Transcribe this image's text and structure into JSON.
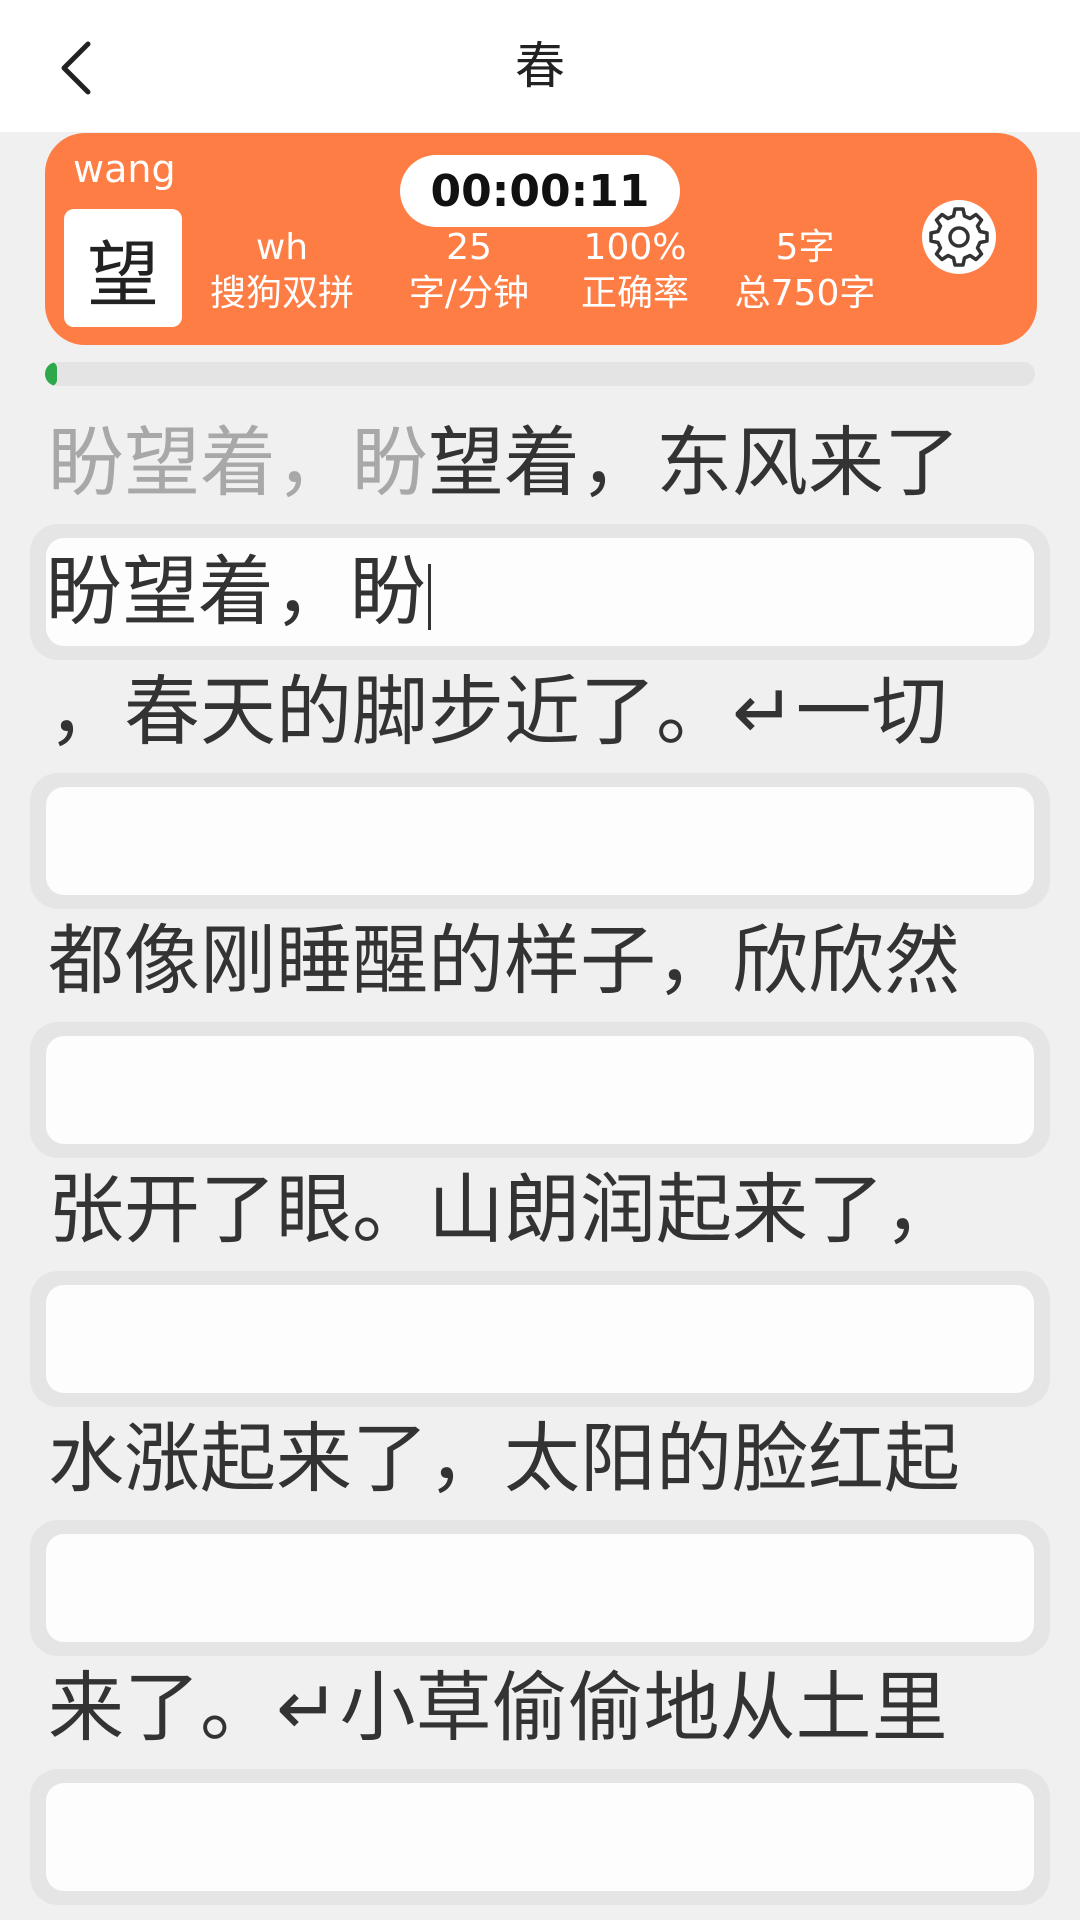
{
  "header": {
    "title": "春"
  },
  "stats": {
    "pinyin": "wang",
    "current_char": "望",
    "timer": "00:00:11",
    "scheme_value": "wh",
    "scheme_label": "搜狗双拼",
    "speed_value": "25",
    "speed_label": "字/分钟",
    "accuracy_value": "100%",
    "accuracy_label": "正确率",
    "count_value": "5字",
    "count_label": "总750字"
  },
  "progress": {
    "typed": 5,
    "total": 750
  },
  "lines": [
    {
      "done": "盼望着，盼",
      "pending": "望着，东风来了",
      "input": "盼望着，盼"
    },
    {
      "done": "",
      "pending": "，春天的脚步近了。↵一切",
      "input": ""
    },
    {
      "done": "",
      "pending": "都像刚睡醒的样子，欣欣然",
      "input": ""
    },
    {
      "done": "",
      "pending": "张开了眼。山朗润起来了，",
      "input": ""
    },
    {
      "done": "",
      "pending": "水涨起来了，太阳的脸红起",
      "input": ""
    },
    {
      "done": "",
      "pending": "来了。↵小草偷偷地从土里",
      "input": ""
    }
  ],
  "colors": {
    "accent": "#fe7d45",
    "progress": "#2ea84a",
    "typed_text": "#a8a8a8"
  },
  "icons": {
    "back": "chevron-left-icon",
    "settings": "gear-icon"
  }
}
